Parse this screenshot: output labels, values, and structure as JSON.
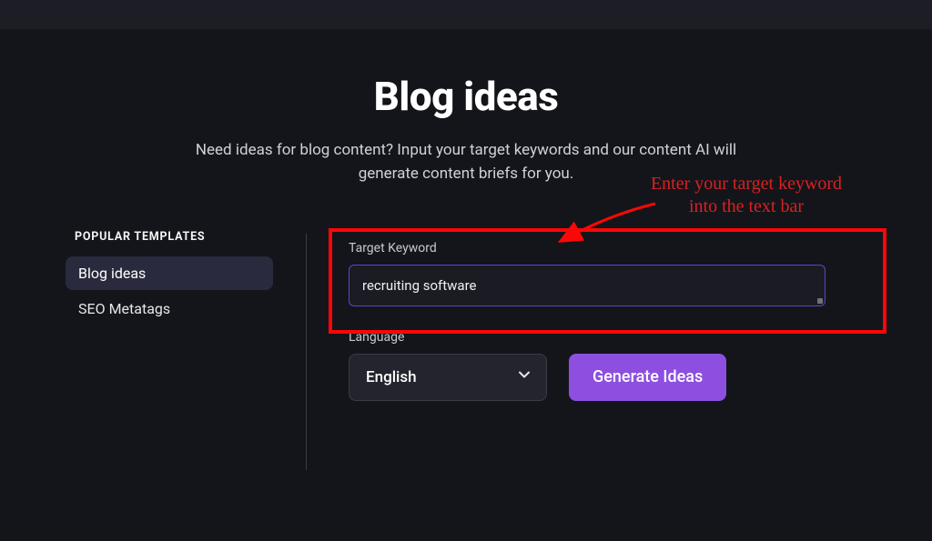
{
  "header": {
    "title": "Blog ideas",
    "subtitle": "Need ideas for blog content? Input your target keywords and our content AI will generate content briefs for you."
  },
  "sidebar": {
    "heading": "POPULAR TEMPLATES",
    "items": [
      {
        "label": "Blog ideas",
        "active": true
      },
      {
        "label": "SEO Metatags",
        "active": false
      }
    ]
  },
  "form": {
    "target_keyword": {
      "label": "Target Keyword",
      "value": "recruiting software",
      "placeholder": ""
    },
    "language": {
      "label": "Language",
      "selected": "English"
    },
    "generate_button": "Generate Ideas"
  },
  "annotation": {
    "text": "Enter your target keyword into the text bar"
  },
  "colors": {
    "accent_purple": "#8e4fe0",
    "input_border": "#5a46c8",
    "highlight_red": "#fb0707",
    "annotation_red": "#d92121",
    "bg": "#14151a"
  }
}
